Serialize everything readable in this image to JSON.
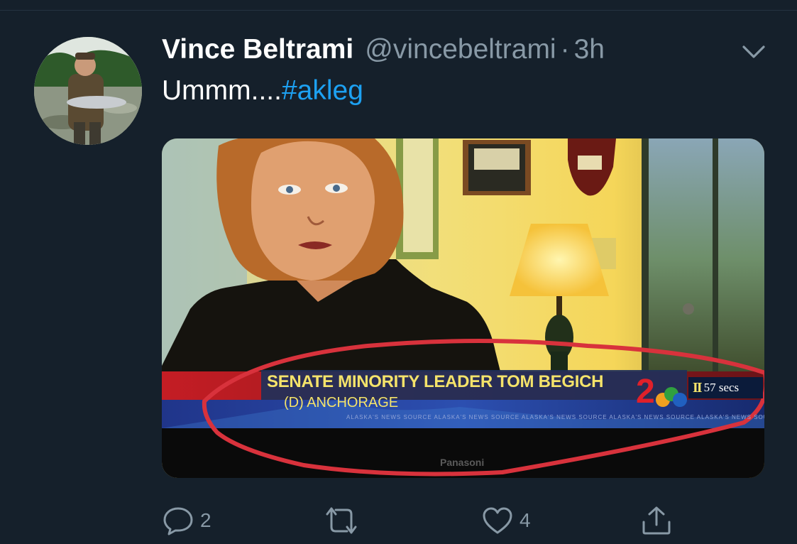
{
  "tweet": {
    "author_name": "Vince Beltrami",
    "handle": "@vincebeltrami",
    "separator": "·",
    "time": "3h",
    "text_plain": "Ummm....",
    "hashtag": "#akleg"
  },
  "media": {
    "chyron_title": "SENATE MINORITY LEADER TOM BEGICH",
    "chyron_subtitle": "(D) ANCHORAGE",
    "timer_icon": "II",
    "timer_text": "57 secs",
    "ticker_text": "ALASKA'S NEWS SOURCE  ALASKA'S NEWS SOURCE  ALASKA'S NEWS SOURCE  ALASKA'S NEWS SOURCE  ALASKA'S NEWS SOURCE",
    "station_number": "2",
    "tv_brand": "Panasoni",
    "annotation_color": "#d8323c"
  },
  "actions": {
    "reply_count": "2",
    "retweet_count": "",
    "like_count": "4"
  },
  "icons": {
    "reply": "speech-bubble-icon",
    "retweet": "retweet-arrows-icon",
    "like": "heart-icon",
    "share": "share-upload-icon",
    "menu": "chevron-down-icon"
  },
  "colors": {
    "background": "#15202b",
    "text": "#ffffff",
    "secondary": "#8899a6",
    "link": "#1da1f2"
  }
}
